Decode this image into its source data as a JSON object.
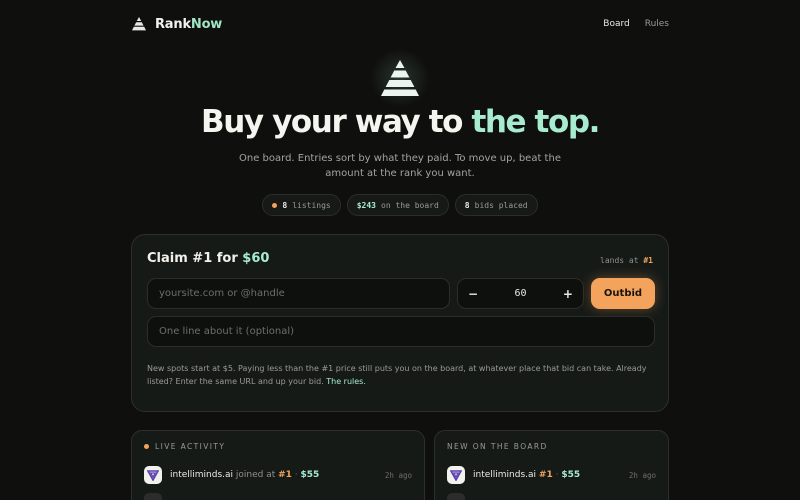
{
  "brand": {
    "name": "Rank",
    "name_accent": "Now"
  },
  "nav": [
    {
      "label": "Board",
      "active": true
    },
    {
      "label": "Rules",
      "active": false
    }
  ],
  "hero": {
    "headline": "Buy your way to ",
    "headline_accent": "the top.",
    "subtitle": "One board. Entries sort by what they paid. To move up, beat the amount at the rank you want."
  },
  "stats": {
    "listings_count": "8",
    "listings_label": "listings",
    "total_amount": "$243",
    "total_label": "on the board",
    "bids_count": "8",
    "bids_label": "bids placed"
  },
  "claim": {
    "title": "Claim #1 for ",
    "title_amount": "$60",
    "lands_label": "lands at",
    "lands_rank": "#1",
    "url_placeholder": "yoursite.com or @handle",
    "amount_value": "60",
    "minus_label": "−",
    "plus_label": "+",
    "outbid_label": "Outbid",
    "about_placeholder": "One line about it (optional)",
    "note": "New spots start at $5. Paying less than the #1 price still puts you on the board, at whatever place that bid can take. Already listed? Enter the same URL and up your bid. ",
    "rules_link": "The rules."
  },
  "live_activity": {
    "heading": "LIVE ACTIVITY",
    "items": [
      {
        "name": "intelliminds.ai",
        "action": " joined at ",
        "rank": "#1",
        "sep": " · ",
        "amount": "$55",
        "time": "2h ago"
      }
    ]
  },
  "new_on_board": {
    "heading": "NEW ON THE BOARD",
    "items": [
      {
        "name": "intelliminds.ai",
        "rank": "#1",
        "sep": " · ",
        "amount": "$55",
        "time": "2h ago"
      }
    ]
  },
  "colors": {
    "background": "#0f0f0e",
    "accent_green": "#a8ecd0",
    "accent_orange": "#f4a35c"
  }
}
